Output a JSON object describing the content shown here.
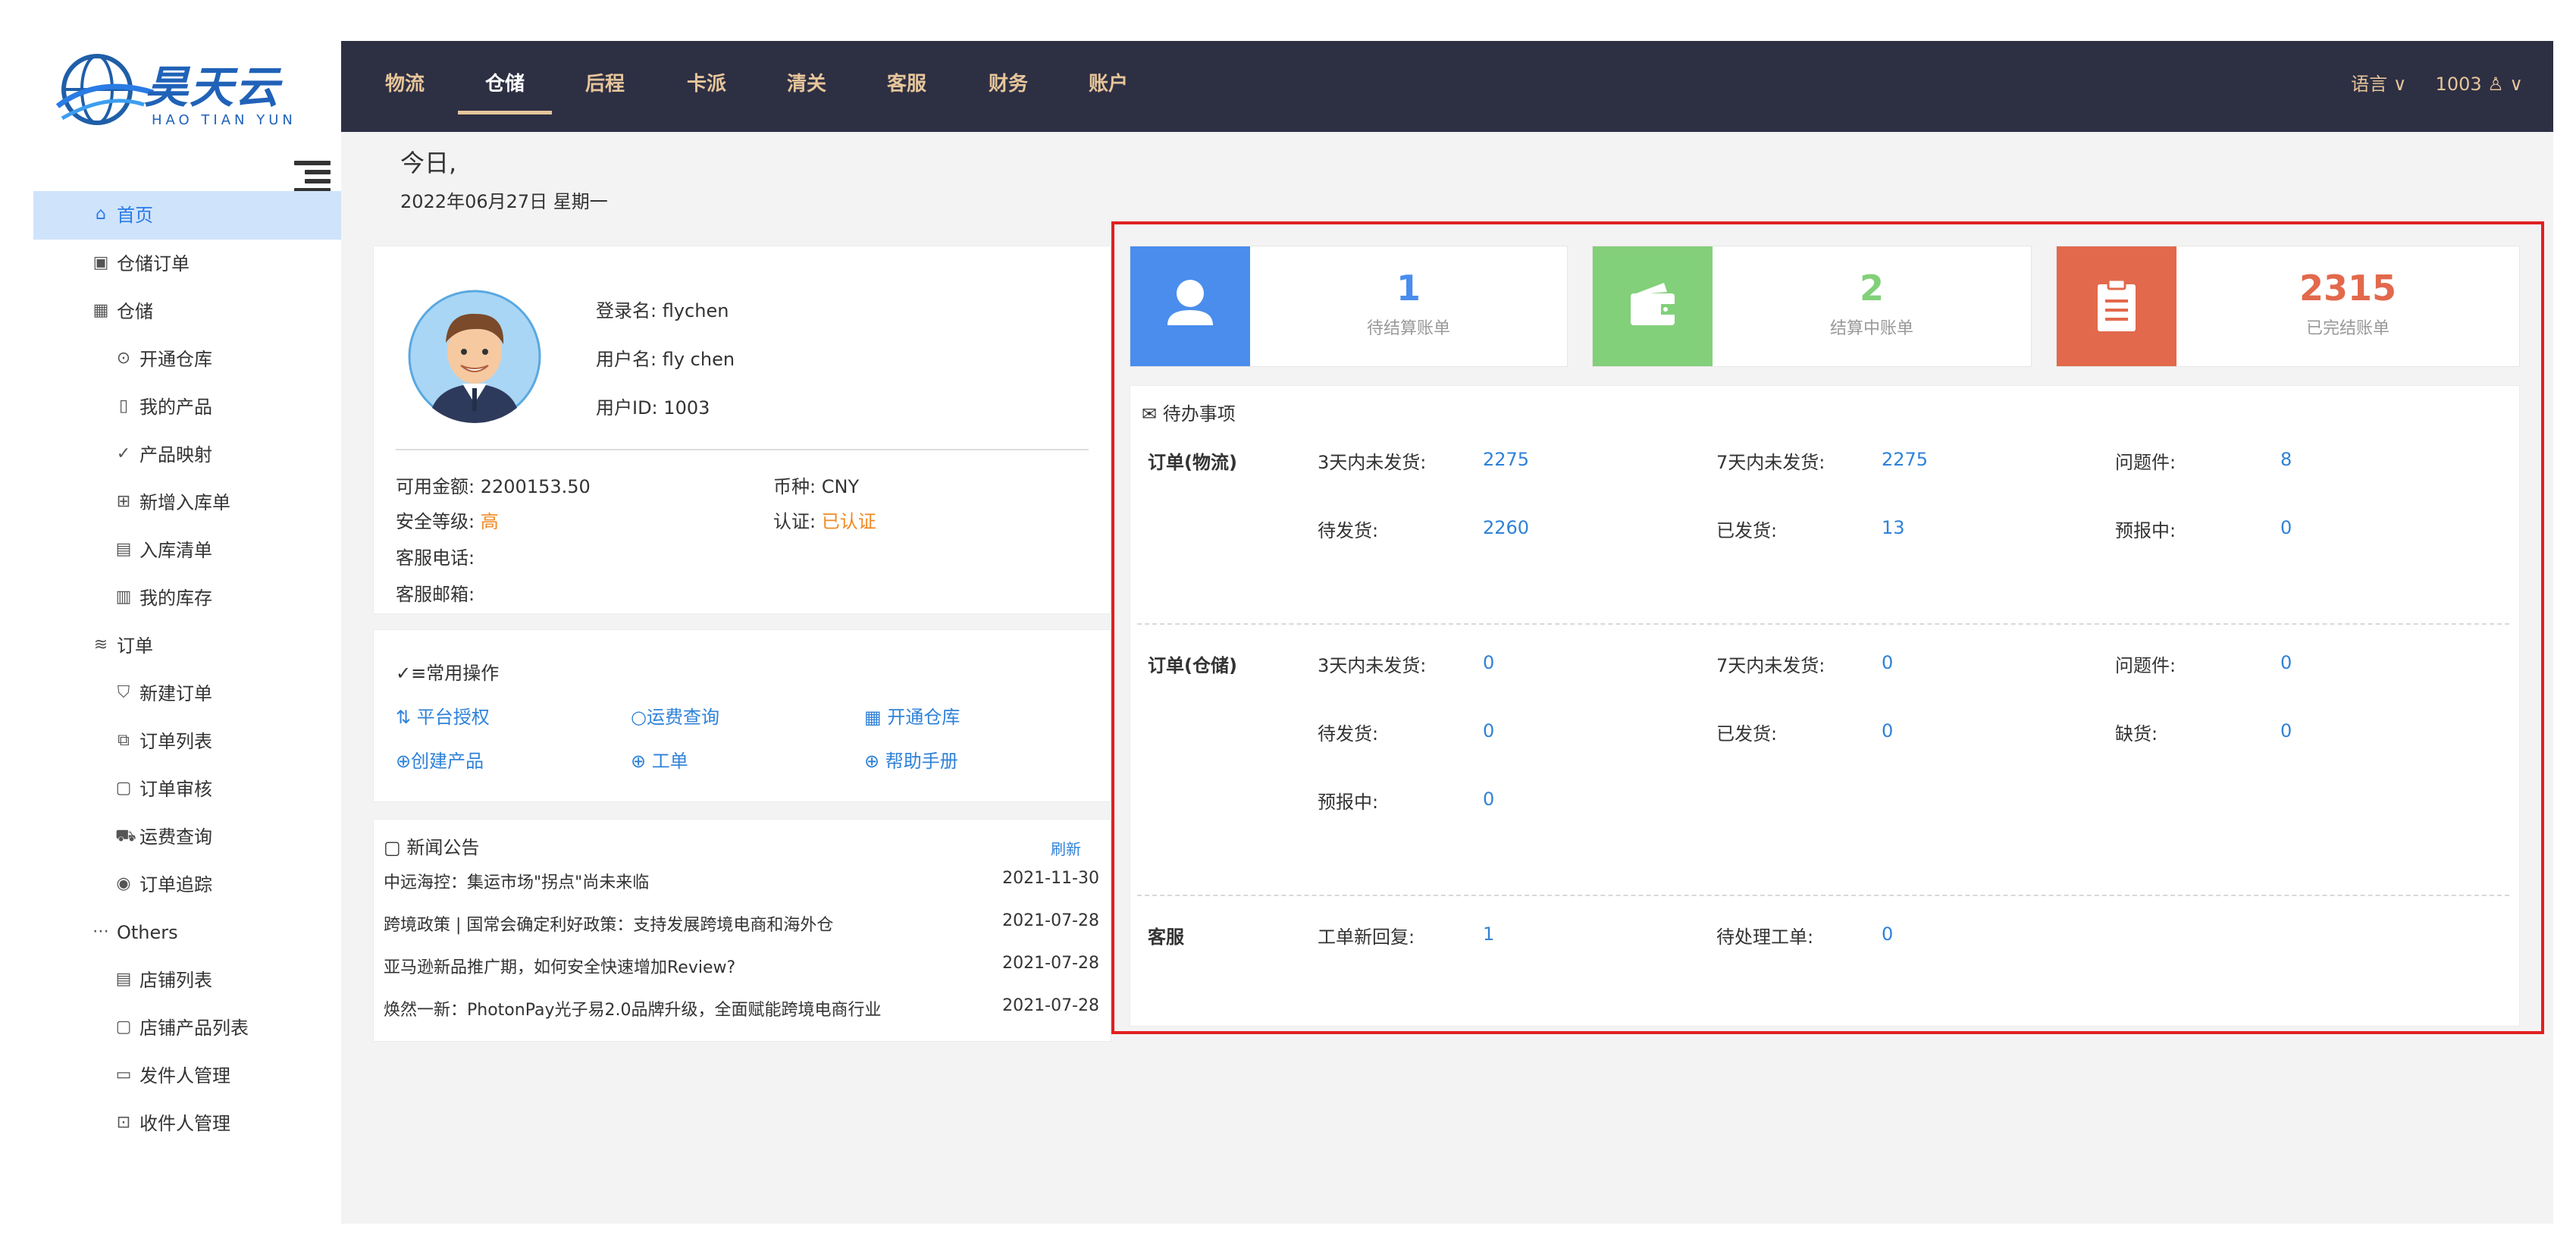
{
  "brand": {
    "name_cn": "昊天云",
    "name_en": "HAO TIAN YUN"
  },
  "nav": {
    "items": [
      "物流",
      "仓储",
      "后程",
      "卡派",
      "清关",
      "客服",
      "财务",
      "账户"
    ],
    "active": "仓储",
    "language": "语言",
    "user_id": "1003"
  },
  "sidebar": {
    "items": [
      {
        "label": "首页",
        "icon": "home-icon"
      },
      {
        "label": "仓储订单",
        "icon": "briefcase-icon"
      },
      {
        "label": "仓储",
        "icon": "building-icon"
      },
      {
        "label": "开通仓库",
        "icon": "plus-circle-icon"
      },
      {
        "label": "我的产品",
        "icon": "phone-icon"
      },
      {
        "label": "产品映射",
        "icon": "list-check-icon"
      },
      {
        "label": "新增入库单",
        "icon": "doc-add-icon"
      },
      {
        "label": "入库清单",
        "icon": "doc-list-icon"
      },
      {
        "label": "我的库存",
        "icon": "warehouse-icon"
      },
      {
        "label": "订单",
        "icon": "database-icon"
      },
      {
        "label": "新建订单",
        "icon": "cart-icon"
      },
      {
        "label": "订单列表",
        "icon": "copy-icon"
      },
      {
        "label": "订单审核",
        "icon": "clipboard-icon"
      },
      {
        "label": "运费查询",
        "icon": "truck-icon"
      },
      {
        "label": "订单追踪",
        "icon": "eye-icon"
      },
      {
        "label": "Others",
        "icon": "ellipsis-icon"
      },
      {
        "label": "店铺列表",
        "icon": "doc-icon"
      },
      {
        "label": "店铺产品列表",
        "icon": "clipboard-icon"
      },
      {
        "label": "发件人管理",
        "icon": "folder-icon"
      },
      {
        "label": "收件人管理",
        "icon": "folder-in-icon"
      }
    ]
  },
  "greeting": {
    "title": "今日,",
    "date": "2022年06月27日 星期一"
  },
  "profile": {
    "login_label": "登录名:",
    "login": "flychen",
    "username_label": "用户名:",
    "username": "fly chen",
    "userid_label": "用户ID:",
    "userid": "1003",
    "balance_label": "可用金额:",
    "balance": "2200153.50",
    "currency_label": "币种:",
    "currency": "CNY",
    "security_label": "安全等级:",
    "security": "高",
    "cert_label": "认证:",
    "cert": "已认证",
    "phone_label": "客服电话:",
    "email_label": "客服邮箱:"
  },
  "common_ops": {
    "title": "常用操作",
    "items": [
      "平台授权",
      "运费查询",
      "开通仓库",
      "创建产品",
      "工单",
      "帮助手册"
    ]
  },
  "news": {
    "title": "新闻公告",
    "refresh": "刷新",
    "items": [
      {
        "title": "中远海控：集运市场\"拐点\"尚未来临",
        "date": "2021-11-30"
      },
      {
        "title": "跨境政策 | 国常会确定利好政策：支持发展跨境电商和海外仓",
        "date": "2021-07-28"
      },
      {
        "title": "亚马逊新品推广期，如何安全快速增加Review?",
        "date": "2021-07-28"
      },
      {
        "title": "焕然一新：PhotonPay光子易2.0品牌升级，全面赋能跨境电商行业",
        "date": "2021-07-28"
      }
    ]
  },
  "stats": [
    {
      "value": "1",
      "label": "待结算账单",
      "color": "#4a8ded"
    },
    {
      "value": "2",
      "label": "结算中账单",
      "color": "#82d07a"
    },
    {
      "value": "2315",
      "label": "已完结账单",
      "color": "#e2694c"
    }
  ],
  "todo": {
    "title": "待办事项",
    "sections": [
      {
        "name": "订单(物流)",
        "rows": [
          [
            {
              "label": "3天内未发货:",
              "value": "2275"
            },
            {
              "label": "7天内未发货:",
              "value": "2275"
            },
            {
              "label": "问题件:",
              "value": "8"
            }
          ],
          [
            {
              "label": "待发货:",
              "value": "2260"
            },
            {
              "label": "已发货:",
              "value": "13"
            },
            {
              "label": "预报中:",
              "value": "0"
            }
          ]
        ]
      },
      {
        "name": "订单(仓储)",
        "rows": [
          [
            {
              "label": "3天内未发货:",
              "value": "0"
            },
            {
              "label": "7天内未发货:",
              "value": "0"
            },
            {
              "label": "问题件:",
              "value": "0"
            }
          ],
          [
            {
              "label": "待发货:",
              "value": "0"
            },
            {
              "label": "已发货:",
              "value": "0"
            },
            {
              "label": "缺货:",
              "value": "0"
            }
          ],
          [
            {
              "label": "预报中:",
              "value": "0"
            }
          ]
        ]
      },
      {
        "name": "客服",
        "rows": [
          [
            {
              "label": "工单新回复:",
              "value": "1"
            },
            {
              "label": "待处理工单:",
              "value": "0"
            }
          ]
        ]
      }
    ]
  }
}
